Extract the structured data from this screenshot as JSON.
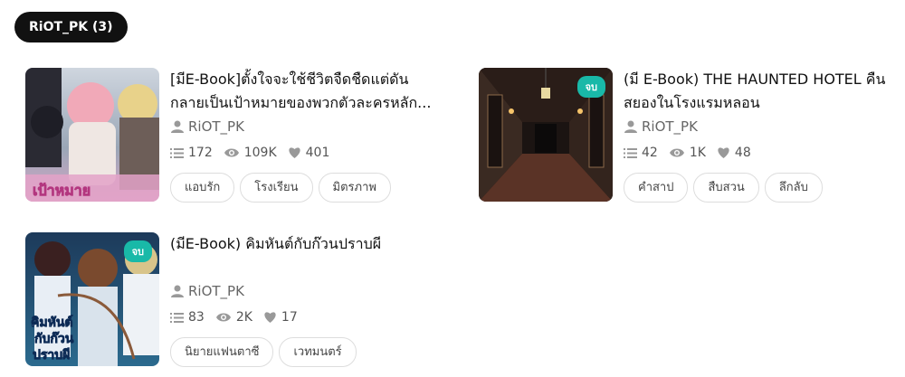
{
  "author_pill": "RiOT_PK (3)",
  "cards": [
    {
      "title": "[มีE-Book]ตั้งใจจะใช้ชีวิตจืดชืดแต่ดันกลายเป็นเป้าหมายของพวกตัวละครหลัก...",
      "author": "RiOT_PK",
      "chapters": "172",
      "views": "109K",
      "likes": "401",
      "tags": [
        "แอบรัก",
        "โรงเรียน",
        "มิตรภาพ"
      ],
      "end_badge": "",
      "cover_text": "เป้าหมาย"
    },
    {
      "title": "(มี E-Book) THE HAUNTED HOTEL คืนสยองในโรงแรมหลอน",
      "author": "RiOT_PK",
      "chapters": "42",
      "views": "1K",
      "likes": "48",
      "tags": [
        "คำสาป",
        "สืบสวน",
        "ลึกลับ"
      ],
      "end_badge": "จบ"
    },
    {
      "title": "(มีE-Book) คิมหันต์กับก๊วนปราบผี",
      "author": "RiOT_PK",
      "chapters": "83",
      "views": "2K",
      "likes": "17",
      "tags": [
        "นิยายแฟนตาซี",
        "เวทมนตร์"
      ],
      "end_badge": "จบ",
      "cover_text": "คิมหันต์กับก๊วนปราบผี"
    }
  ],
  "colors": {
    "badge": "#19b9a8",
    "pill": "#111111",
    "icon": "#999999"
  }
}
